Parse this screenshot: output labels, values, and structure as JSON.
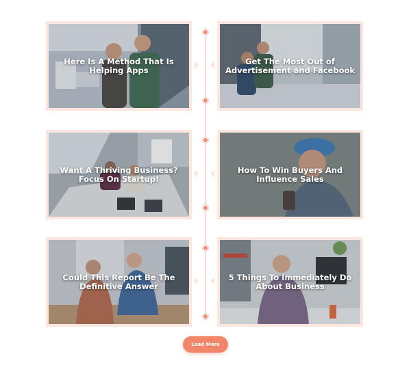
{
  "posts": [
    {
      "title": "Here Is A Method That Is Helping Apps"
    },
    {
      "title": "Get The Most Out of Advertisement and Facebook"
    },
    {
      "title": "Want A Thriving Business? Focus On Startup!"
    },
    {
      "title": "How To Win Buyers And Influence Sales"
    },
    {
      "title": "Could This Report Be The Definitive Answer"
    },
    {
      "title": "5 Things To Immediately Do About Business"
    }
  ],
  "load_more_label": "Load More",
  "colors": {
    "accent": "#f2866b",
    "card_frame": "#fde6de",
    "timeline": "#f7ddd5"
  }
}
